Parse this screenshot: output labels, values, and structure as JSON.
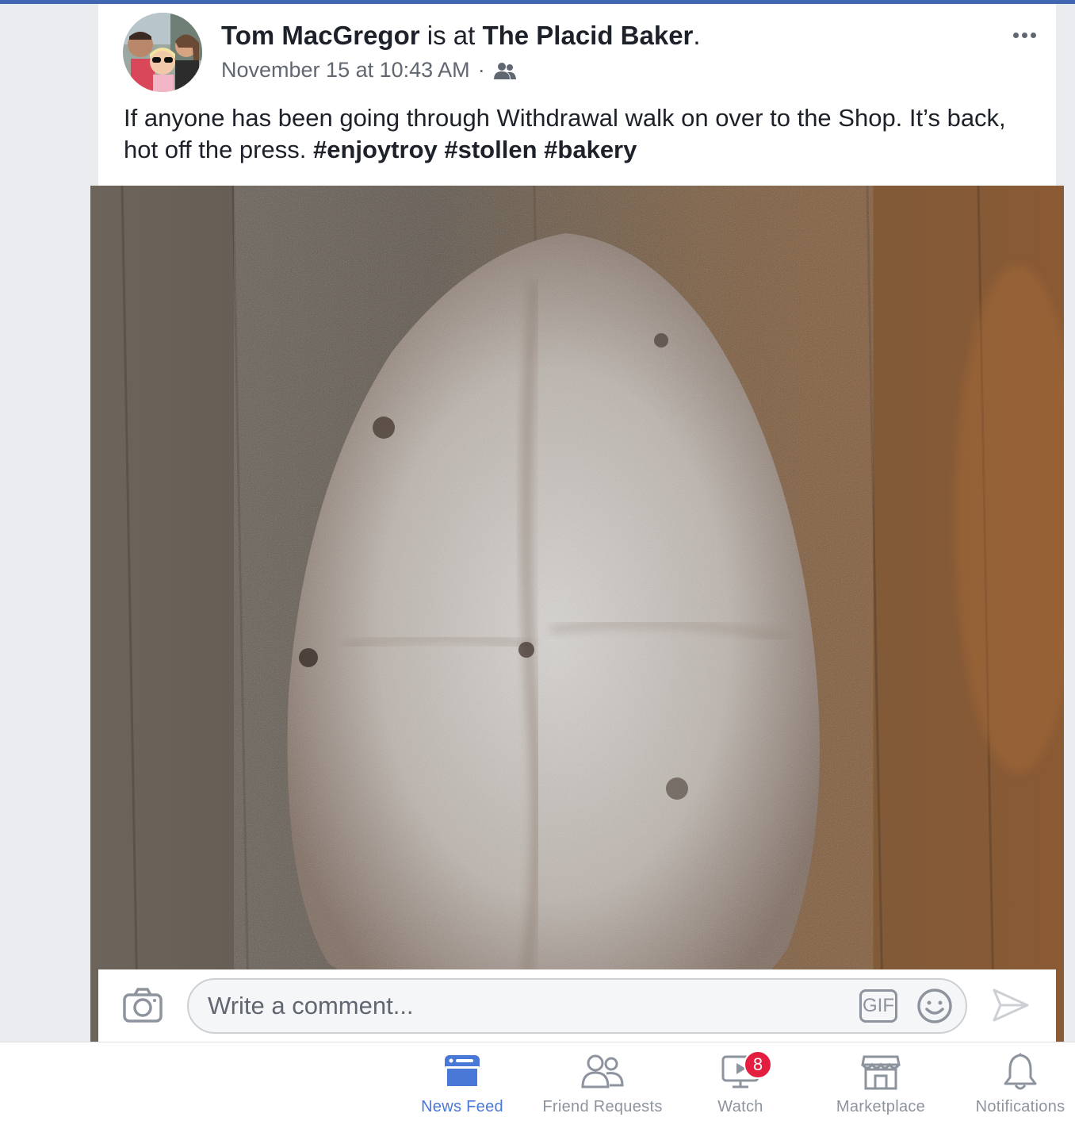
{
  "post": {
    "author": "Tom MacGregor",
    "connector": " is at ",
    "place": "The Placid Baker",
    "period": ".",
    "timestamp": "November 15 at 10:43 AM",
    "separator": "·",
    "audience_icon": "friends-icon",
    "text_main": "If anyone has been going through Withdrawal walk on over to the Shop. It’s  back, hot off the press. ",
    "hashtags": [
      "#enjoytroy",
      "#stollen",
      "#bakery"
    ],
    "more_icon": "more-options-icon"
  },
  "comment": {
    "placeholder": "Write a comment...",
    "gif_label": "GIF",
    "camera_icon": "camera-icon",
    "emoji_icon": "emoji-icon",
    "send_icon": "send-icon"
  },
  "tabbar": {
    "items": [
      {
        "label": "News Feed",
        "icon": "news-feed-icon",
        "active": true
      },
      {
        "label": "Friend Requests",
        "icon": "friend-requests-icon",
        "active": false
      },
      {
        "label": "Watch",
        "icon": "watch-icon",
        "active": false,
        "badge": "8"
      },
      {
        "label": "Marketplace",
        "icon": "marketplace-icon",
        "active": false
      },
      {
        "label": "Notifications",
        "icon": "notifications-icon",
        "active": false
      }
    ]
  },
  "colors": {
    "brand": "#4267b2",
    "active_tab": "#4a78d6",
    "badge": "#e41e3f",
    "inactive": "#8d949e"
  }
}
